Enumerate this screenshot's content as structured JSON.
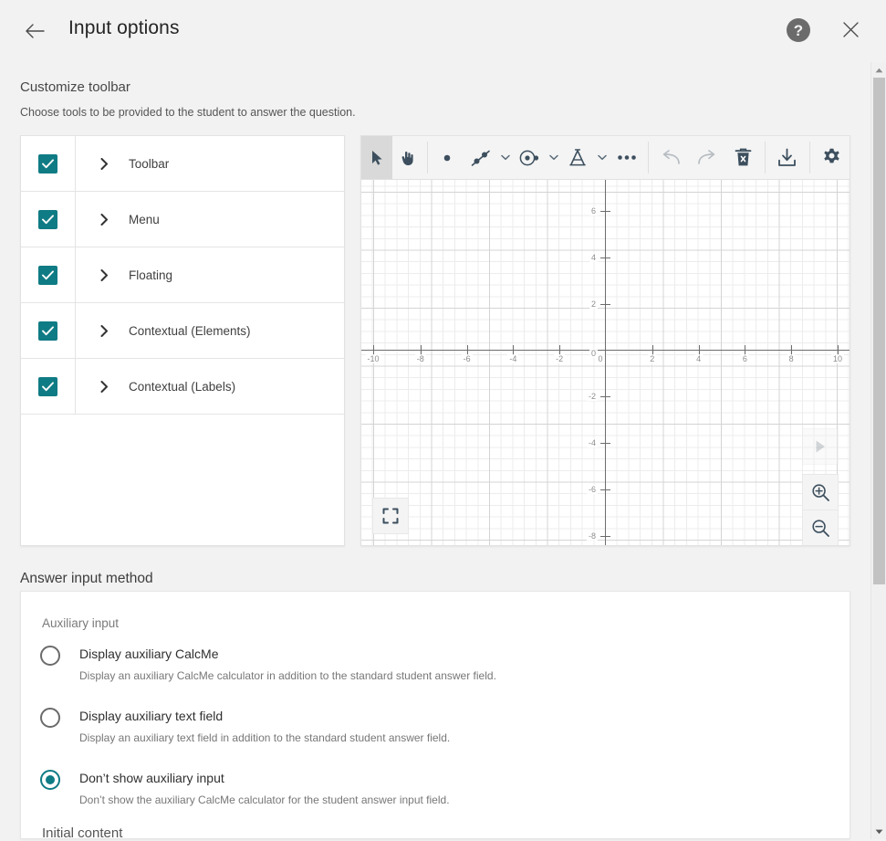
{
  "header": {
    "title": "Input options",
    "back_icon": "arrow-left-icon",
    "help_icon": "help-icon",
    "help_glyph": "?",
    "close_icon": "close-icon"
  },
  "customize": {
    "title": "Customize toolbar",
    "subtitle": "Choose tools to be provided to the student to answer the question.",
    "items": [
      {
        "label": "Toolbar",
        "checked": true
      },
      {
        "label": "Menu",
        "checked": true
      },
      {
        "label": "Floating",
        "checked": true
      },
      {
        "label": "Contextual (Elements)",
        "checked": true
      },
      {
        "label": "Contextual (Labels)",
        "checked": true
      }
    ]
  },
  "graph": {
    "tools": [
      {
        "name": "select-arrow-tool",
        "active": true
      },
      {
        "name": "pan-hand-tool",
        "active": false
      },
      {
        "name": "point-tool",
        "active": false
      },
      {
        "name": "line-tool",
        "active": false,
        "has_dropdown": true
      },
      {
        "name": "circle-tool",
        "active": false,
        "has_dropdown": true
      },
      {
        "name": "compass-tool",
        "active": false,
        "has_dropdown": true
      },
      {
        "name": "more-options-tool",
        "active": false
      }
    ],
    "actions": [
      {
        "name": "undo-button",
        "disabled": true
      },
      {
        "name": "redo-button",
        "disabled": true
      },
      {
        "name": "delete-button",
        "disabled": false
      },
      {
        "name": "download-button",
        "disabled": false
      },
      {
        "name": "settings-gear-button",
        "disabled": false
      }
    ],
    "controls": [
      {
        "name": "play-button",
        "disabled": true
      },
      {
        "name": "zoom-in-button",
        "disabled": false
      },
      {
        "name": "zoom-out-button",
        "disabled": false
      },
      {
        "name": "fullscreen-button",
        "disabled": false
      }
    ],
    "chart_data": {
      "type": "scatter",
      "title": "",
      "xlabel": "",
      "ylabel": "",
      "grid": true,
      "legend": "none",
      "xlim": [
        -11,
        11
      ],
      "ylim": [
        -9,
        7
      ],
      "x_ticks": [
        "-10",
        "-8",
        "-6",
        "-4",
        "-2",
        "0",
        "2",
        "4",
        "6",
        "8",
        "10"
      ],
      "y_ticks": [
        "6",
        "4",
        "2",
        "0",
        "-2",
        "-4",
        "-6",
        "-8"
      ],
      "x_tick_values": [
        -10,
        -8,
        -6,
        -4,
        -2,
        0,
        2,
        4,
        6,
        8,
        10
      ],
      "y_tick_values": [
        6,
        4,
        2,
        0,
        -2,
        -4,
        -6,
        -8
      ],
      "series": [],
      "points": []
    }
  },
  "answer": {
    "section_title": "Answer input method",
    "group_label": "Auxiliary input",
    "options": [
      {
        "label": "Display auxiliary CalcMe",
        "description": "Display an auxiliary CalcMe calculator in addition to the standard student answer field.",
        "selected": false
      },
      {
        "label": "Display auxiliary text field",
        "description": "Display an auxiliary text field in addition to the standard student answer field.",
        "selected": false
      },
      {
        "label": "Don’t show auxiliary input",
        "description": "Don’t show the auxiliary CalcMe calculator for the student answer input field.",
        "selected": true
      }
    ],
    "next_section_title": "Initial content"
  },
  "scrollbar": {
    "up_icon": "caret-up-icon",
    "down_icon": "caret-down-icon"
  },
  "colors": {
    "accent": "#0f7b84",
    "background": "#f2f2f2",
    "panel": "#ffffff",
    "icon": "#3d4f5e"
  }
}
